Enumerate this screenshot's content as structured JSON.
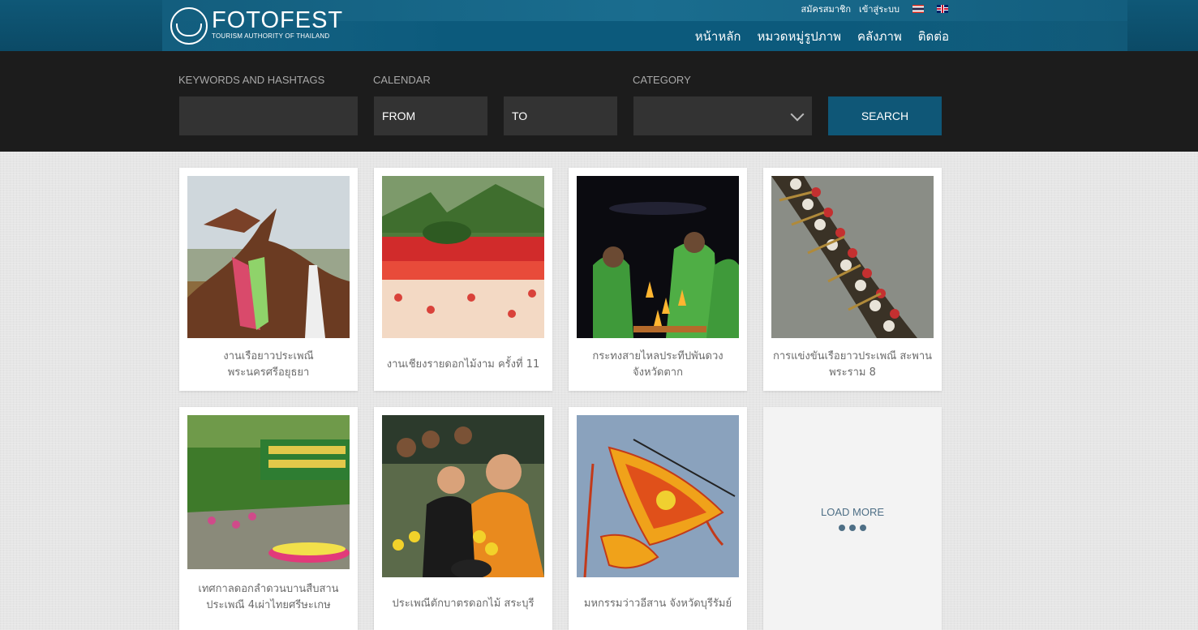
{
  "header": {
    "logo_title": "FOTOFEST",
    "logo_subtitle": "TOURISM AUTHORITY OF THAILAND",
    "top_links": [
      "สมัครสมาชิก",
      "เข้าสู่ระบบ"
    ],
    "languages": [
      "thai-flag-icon",
      "uk-flag-icon"
    ],
    "nav": [
      "หน้าหลัก",
      "หมวดหมู่รูปภาพ",
      "คลังภาพ",
      "ติดต่อ"
    ]
  },
  "search": {
    "keywords_label": "KEYWORDS AND HASHTAGS",
    "keywords_value": "",
    "calendar_label": "CALENDAR",
    "from_value": "FROM",
    "to_value": "TO",
    "category_label": "CATEGORY",
    "category_value": "",
    "button": "SEARCH"
  },
  "gallery": [
    {
      "line1": "งานเรือยาวประเพณี",
      "line2": "พระนครศรีอยุธยา",
      "image": "dragon-boat-prow-photo"
    },
    {
      "line1": "งานเชียงรายดอกไม้งาม ครั้งที่ 11",
      "line2": "",
      "image": "flower-garden-photo"
    },
    {
      "line1": "กระทงสายไหลประทีปพันดวง",
      "line2": "จังหวัดตาก",
      "image": "candle-ceremony-photo"
    },
    {
      "line1": "การแข่งขันเรือยาวประเพณี สะพาน",
      "line2": "พระราม 8",
      "image": "rowing-boat-aerial-photo"
    },
    {
      "line1": "เทศกาลดอกลำดวนบานสืบสาน",
      "line2": "ประเพณี 4เผ่าไทยศรีษะเกษ",
      "image": "festival-garden-photo"
    },
    {
      "line1": "ประเพณีตักบาตรดอกไม้ สระบุรี",
      "line2": "",
      "image": "monk-flower-offering-photo"
    },
    {
      "line1": "มหกรรมว่าวอีสาน จังหวัดบุรีรัมย์",
      "line2": "",
      "image": "kite-festival-photo"
    }
  ],
  "load_more": "LOAD MORE",
  "colors": {
    "header_blue": "#0f5877",
    "search_bg": "#1c1c1c",
    "button_blue": "#0f5777",
    "load_more_text": "#4e6f86"
  }
}
